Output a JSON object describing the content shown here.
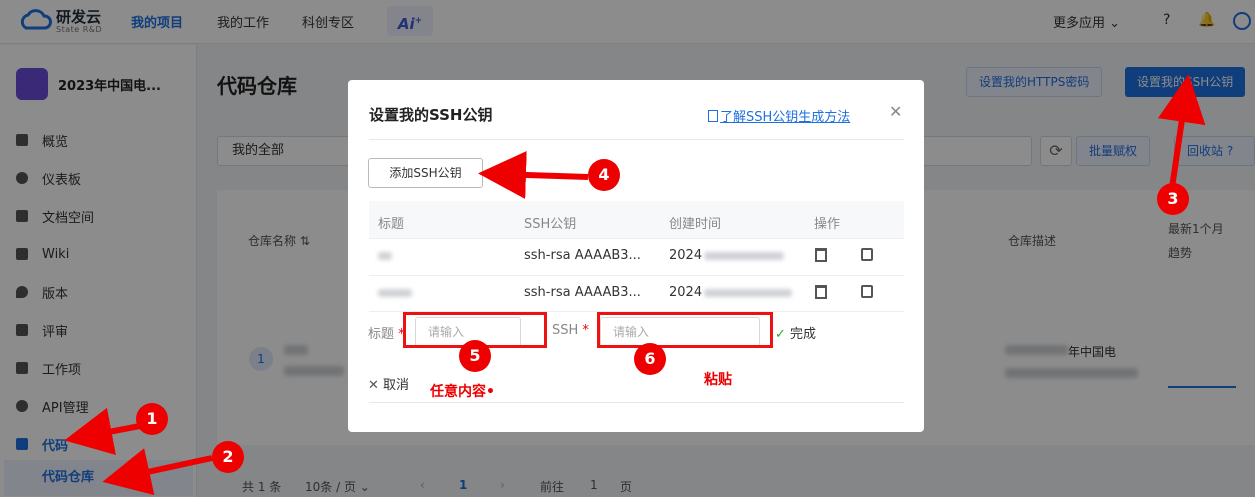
{
  "topbar": {
    "logo_name": "研发云",
    "logo_sub": "State R&D",
    "nav": [
      "我的项目",
      "我的工作",
      "科创专区"
    ],
    "ai_label": "Ai",
    "more_apps": "更多应用"
  },
  "sidebar": {
    "project_name": "2023年中国电...",
    "items": [
      "概览",
      "仪表板",
      "文档空间",
      "Wiki",
      "版本",
      "评审",
      "工作项",
      "API管理",
      "代码"
    ],
    "sub_item": "代码仓库"
  },
  "main": {
    "title": "代码仓库",
    "btn_https": "设置我的HTTPS密码",
    "btn_ssh": "设置我的SSH公钥",
    "filter_all": "我的全部",
    "btn_batch": "批量赋权",
    "btn_recycle": "回收站",
    "col_repo_name": "仓库名称",
    "col_desc": "仓库描述",
    "col_trend": "最新1个月",
    "col_trend2": "趋势",
    "row_index": "1",
    "row_desc": "年中国电",
    "footer_total": "共 1 条",
    "footer_page_size": "10条 / 页",
    "footer_page": "1",
    "footer_goto": "前往",
    "footer_goto_page": "1",
    "footer_page_unit": "页"
  },
  "modal": {
    "title": "设置我的SSH公钥",
    "help_link": "了解SSH公钥生成方法",
    "add_button": "添加SSH公钥",
    "headers": [
      "标题",
      "SSH公钥",
      "创建时间",
      "操作"
    ],
    "rows": [
      {
        "key": "ssh-rsa AAAAB3...",
        "time": "2024"
      },
      {
        "key": "ssh-rsa AAAAB3...",
        "time": "2024"
      }
    ],
    "title_label": "标题",
    "ssh_label": "SSH",
    "placeholder_title": "请输入",
    "placeholder_ssh": "请输入",
    "done_label": "完成",
    "cancel_label": "取消"
  },
  "annotations": {
    "numbers": [
      "1",
      "2",
      "3",
      "4",
      "5",
      "6"
    ],
    "note_title": "任意内容•",
    "note_ssh": "粘贴"
  }
}
